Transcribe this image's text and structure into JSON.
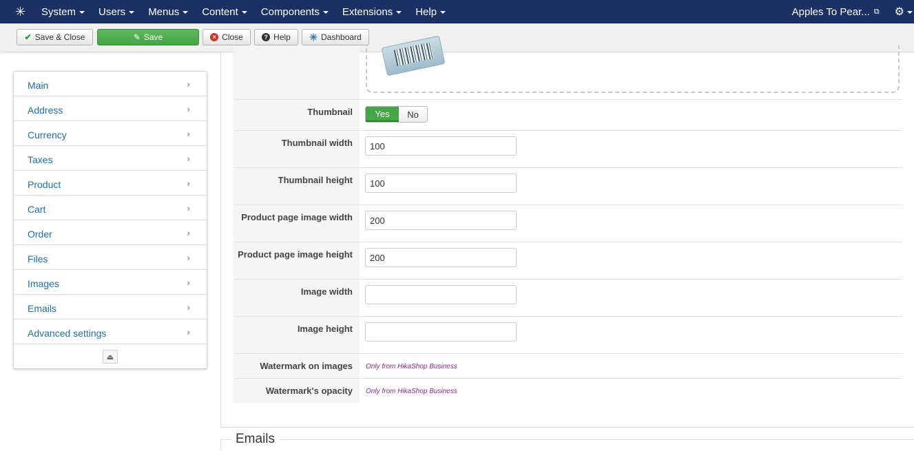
{
  "navbar": {
    "menu": [
      {
        "label": "System"
      },
      {
        "label": "Users"
      },
      {
        "label": "Menus"
      },
      {
        "label": "Content"
      },
      {
        "label": "Components"
      },
      {
        "label": "Extensions"
      },
      {
        "label": "Help"
      }
    ],
    "site_label": "Apples To Pear...",
    "logo_icon": "joomla-logo-icon",
    "settings_icon": "gear-icon"
  },
  "toolbar": {
    "save_close": "Save & Close",
    "save": "Save",
    "close": "Close",
    "help": "Help",
    "dashboard": "Dashboard"
  },
  "sidebar": {
    "items": [
      {
        "label": "Main"
      },
      {
        "label": "Address"
      },
      {
        "label": "Currency"
      },
      {
        "label": "Taxes"
      },
      {
        "label": "Product"
      },
      {
        "label": "Cart"
      },
      {
        "label": "Order"
      },
      {
        "label": "Files"
      },
      {
        "label": "Images"
      },
      {
        "label": "Emails"
      },
      {
        "label": "Advanced settings"
      }
    ]
  },
  "images": {
    "thumbnail": {
      "label": "Thumbnail",
      "yes": "Yes",
      "no": "No",
      "selected": "Yes"
    },
    "thumbnail_width": {
      "label": "Thumbnail width",
      "value": "100"
    },
    "thumbnail_height": {
      "label": "Thumbnail height",
      "value": "100"
    },
    "product_image_width": {
      "label": "Product page image width",
      "value": "200"
    },
    "product_image_height": {
      "label": "Product page image height",
      "value": "200"
    },
    "image_width": {
      "label": "Image width",
      "value": ""
    },
    "image_height": {
      "label": "Image height",
      "value": ""
    },
    "watermark": {
      "label": "Watermark on images",
      "note": "Only from HikaShop Business"
    },
    "watermark_opacity": {
      "label": "Watermark's opacity",
      "note": "Only from HikaShop Business"
    }
  },
  "emails_section": {
    "legend": "Emails"
  },
  "colors": {
    "navbar": "#1b3164",
    "save_green": "#46a546",
    "link_blue": "#1f6ea8",
    "note_purple": "#8a2a87"
  }
}
